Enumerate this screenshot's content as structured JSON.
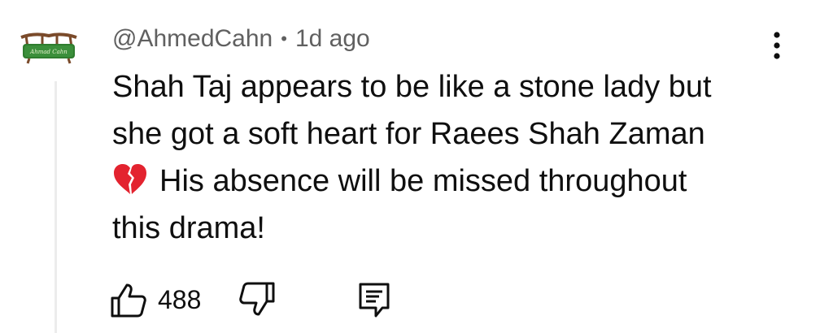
{
  "comment": {
    "author": "@AhmedCahn",
    "separator": "•",
    "time": "1d ago",
    "text_lines": [
      "Shah Taj appears to be like a stone lady but",
      "she got a soft heart for Raees Shah Zaman",
      "His absence will be missed throughout",
      "this drama!"
    ],
    "emoji": "broken-heart-icon",
    "avatar_text": "Ahmad Cahn",
    "like_count": "488"
  },
  "icons": {
    "more": "more-vertical-icon",
    "like": "thumbs-up-icon",
    "dislike": "thumbs-down-icon",
    "reply": "reply-comment-icon"
  },
  "colors": {
    "text": "#0f0f0f",
    "meta": "#606060",
    "heart": "#e3232f",
    "thread_line": "#ececec"
  }
}
